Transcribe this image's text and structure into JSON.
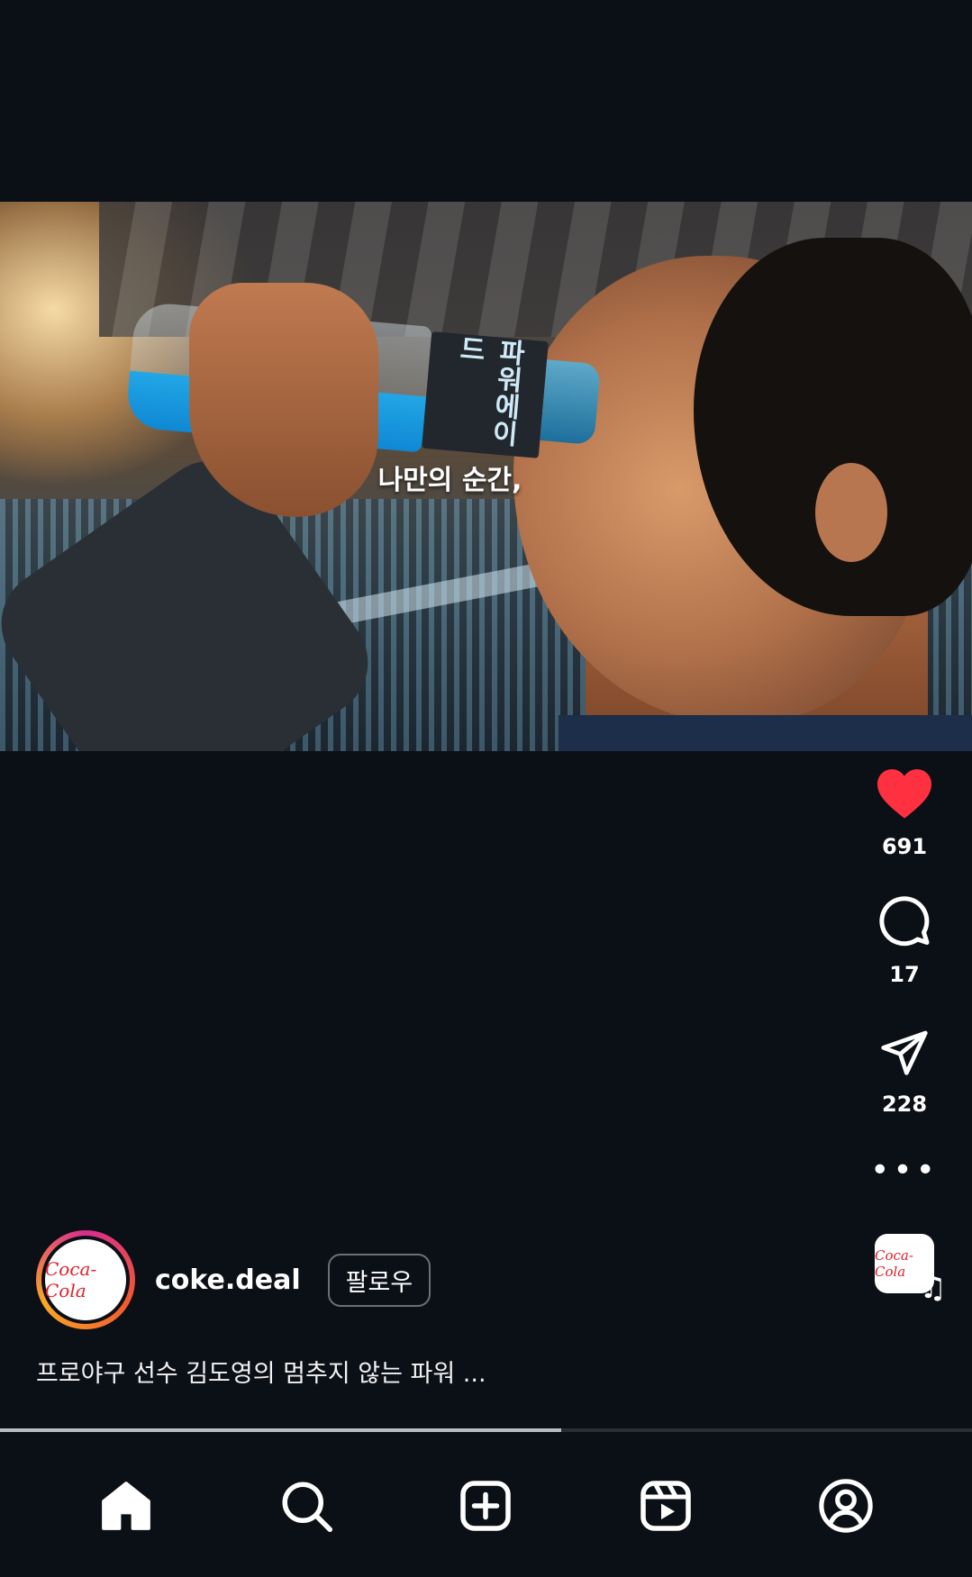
{
  "video": {
    "subtitle": "나만의 순간,",
    "bottle_label": "파워에이드",
    "progress": 0.577
  },
  "actions": {
    "likes": "691",
    "comments": "17",
    "shares": "228",
    "liked_color": "#ff3040"
  },
  "audio": {
    "logo_text": "Coca-Cola"
  },
  "profile": {
    "avatar_text": "Coca-Cola",
    "username": "coke.deal",
    "follow_label": "팔로우"
  },
  "caption": {
    "text": "프로야구 선수 김도영의 멈추지 않는 파워 ..."
  },
  "nav": {
    "items": [
      "home-icon",
      "search-icon",
      "create-icon",
      "reels-icon",
      "profile-icon"
    ]
  }
}
